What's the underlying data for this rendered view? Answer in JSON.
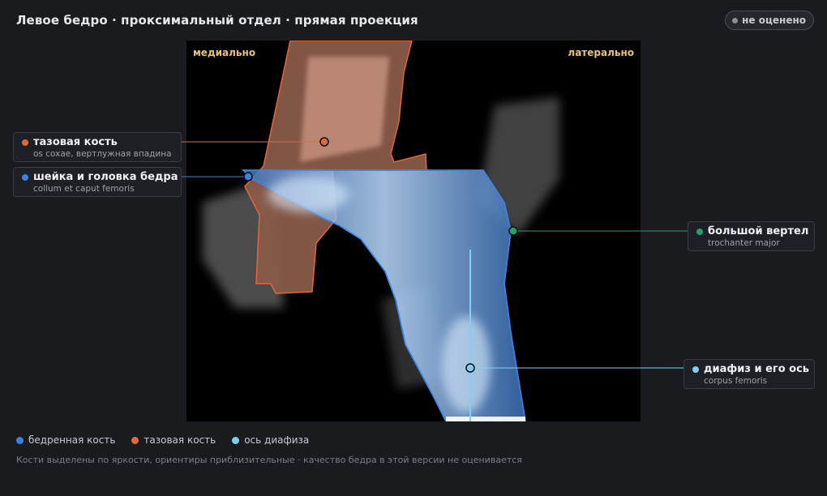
{
  "header": {
    "title": "Левое бедро · проксимальный отдел · прямая проекция",
    "status": "не оценено"
  },
  "viewer": {
    "orientation_left": "медиально",
    "orientation_right": "латерально"
  },
  "labels": [
    {
      "name": "тазовая кость",
      "latin": "os coxae, вертлужная впадина",
      "color": "#e0683a"
    },
    {
      "name": "шейка и головка бедра",
      "latin": "collum et caput femoris",
      "color": "#3b82e0"
    },
    {
      "name": "большой вертел",
      "latin": "trochanter major",
      "color": "#22a36a"
    },
    {
      "name": "диафиз и его ось",
      "latin": "corpus femoris",
      "color": "#7fd0f5"
    }
  ],
  "legend": [
    {
      "label": "бедренная кость",
      "color": "#3b82e0"
    },
    {
      "label": "тазовая кость",
      "color": "#e0683a"
    },
    {
      "label": "ось диафиза",
      "color": "#7fd0f5"
    }
  ],
  "footnote": "Кости выделены по яркости, ориентиры приблизительные · качество бедра в этой версии не оценивается"
}
